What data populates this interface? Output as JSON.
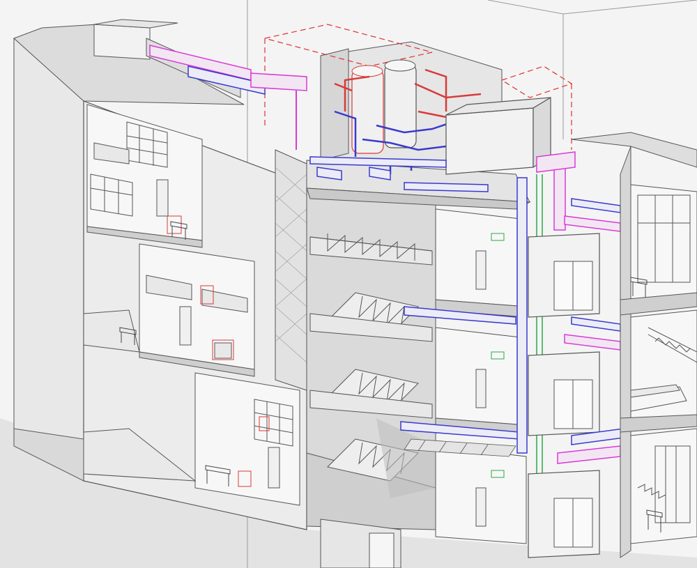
{
  "view": {
    "kind": "isometric building section with MEP systems"
  },
  "colors": {
    "background": "#f4f4f4",
    "ground": "#e3e3e3",
    "wall_face": "#ececec",
    "wall_side": "#d9d9d9",
    "wall_shade": "#c9c9c9",
    "slab": "#dedede",
    "line": "#555555",
    "line_light": "#8a8a8a",
    "supply_duct": "#3a3acc",
    "exhaust_duct": "#d83ad8",
    "hot_pipe": "#d83a3a",
    "green_pipe": "#2aa84a",
    "reserved_zone": "#e03030",
    "equipment": "#f2f2f2",
    "tank": "#f0f0f0"
  },
  "systems": [
    {
      "name": "supply-air-duct",
      "color_key": "supply_duct"
    },
    {
      "name": "exhaust-air-duct",
      "color_key": "exhaust_duct"
    },
    {
      "name": "heating-pipe",
      "color_key": "hot_pipe"
    },
    {
      "name": "plumbing-riser",
      "color_key": "green_pipe"
    },
    {
      "name": "clearance-zone",
      "color_key": "reserved_zone"
    }
  ],
  "icons": [
    "tank-icon",
    "chair-icon",
    "door-icon",
    "stair-icon",
    "sofa-icon",
    "shelf-icon"
  ]
}
